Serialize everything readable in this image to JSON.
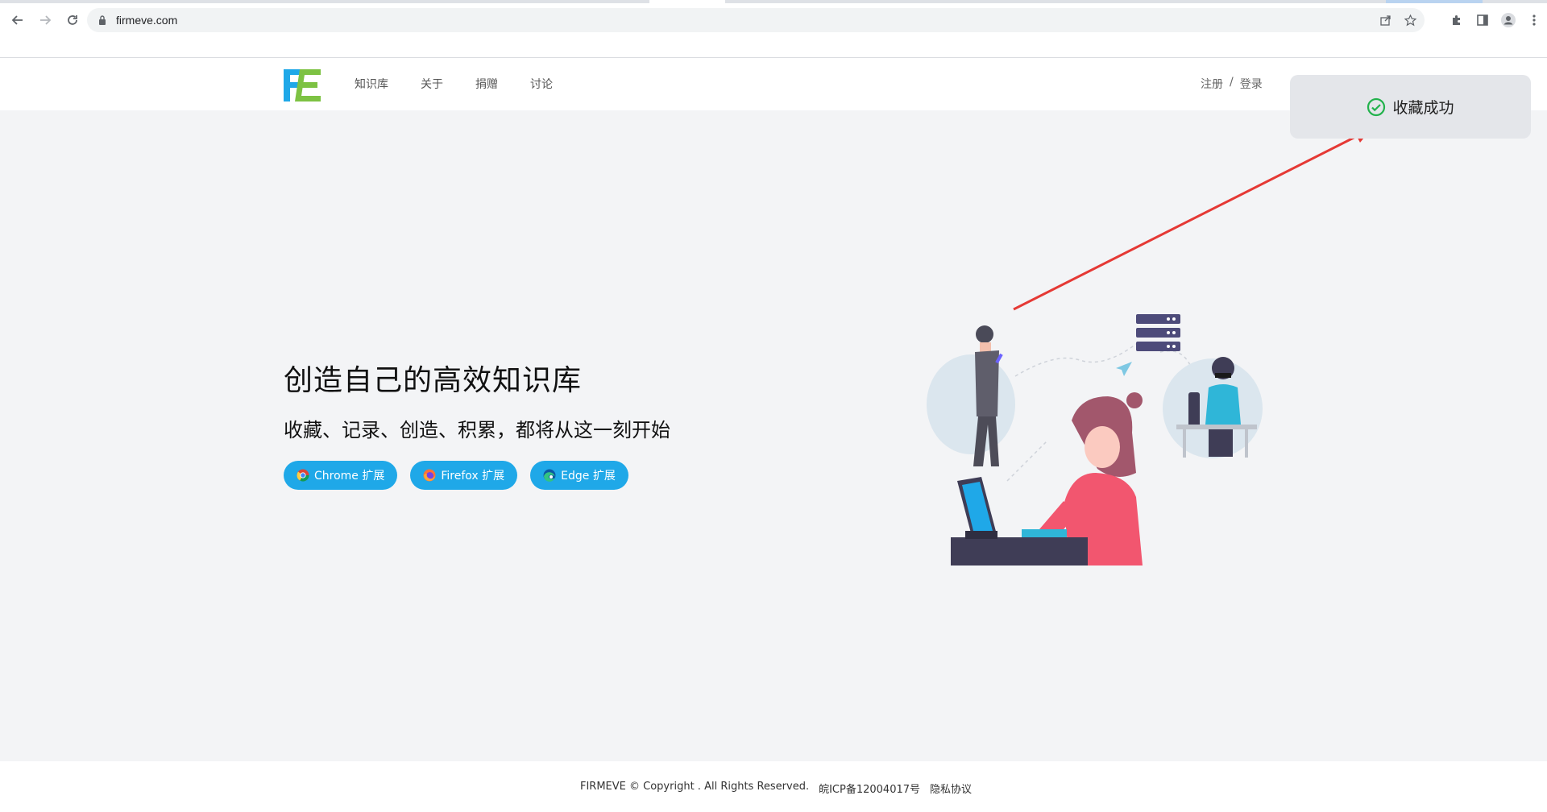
{
  "browser": {
    "url": "firmeve.com"
  },
  "header": {
    "nav": [
      "知识库",
      "关于",
      "捐赠",
      "讨论"
    ],
    "register": "注册",
    "separator": "/",
    "login": "登录"
  },
  "hero": {
    "title": "创造自己的高效知识库",
    "subtitle": "收藏、记录、创造、积累，都将从这一刻开始",
    "buttons": [
      {
        "label": "Chrome 扩展",
        "icon": "chrome-icon"
      },
      {
        "label": "Firefox 扩展",
        "icon": "firefox-icon"
      },
      {
        "label": "Edge 扩展",
        "icon": "edge-icon"
      }
    ]
  },
  "footer": {
    "copyright": "FIRMEVE © Copyright . All Rights Reserved.",
    "icp": "皖ICP备12004017号",
    "privacy": "隐私协议"
  },
  "toast": {
    "message": "收藏成功",
    "icon": "check-circle-icon"
  },
  "colors": {
    "accent": "#1fa8e8",
    "toast_bg": "#e4e6ea",
    "success": "#22b24c",
    "arrow": "#e53935"
  }
}
